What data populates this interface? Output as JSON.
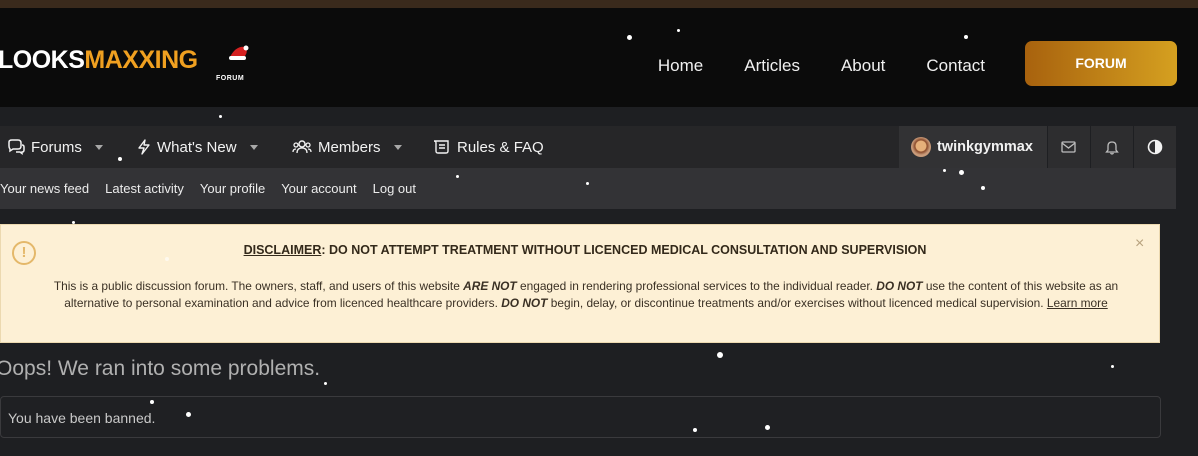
{
  "header": {
    "logo_left": "LOOKS",
    "logo_right": "MAXXING",
    "logo_sub": "FORUM",
    "nav": [
      "Home",
      "Articles",
      "About",
      "Contact"
    ],
    "forum_button": "FORUM"
  },
  "forum_nav": {
    "items": [
      {
        "label": "Forums",
        "icon": "forums-icon"
      },
      {
        "label": "What's New",
        "icon": "bolt-icon"
      },
      {
        "label": "Members",
        "icon": "members-icon"
      },
      {
        "label": "Rules & FAQ",
        "icon": "rules-icon"
      }
    ],
    "username": "twinkgymmax"
  },
  "sub_nav": [
    "Your news feed",
    "Latest activity",
    "Your profile",
    "Your account",
    "Log out"
  ],
  "notice": {
    "title_underlined": "DISCLAIMER",
    "title_rest": ": DO NOT ATTEMPT TREATMENT WITHOUT LICENCED MEDICAL CONSULTATION AND SUPERVISION",
    "body_1": "This is a public discussion forum. The owners, staff, and users of this website ",
    "em_1": "ARE NOT",
    "body_2": " engaged in rendering professional services to the individual reader. ",
    "em_2": "DO NOT",
    "body_3": " use the content of this website as an alternative to personal examination and advice from licenced healthcare providers. ",
    "em_3": "DO NOT",
    "body_4": " begin, delay, or discontinue treatments and/or exercises without licenced medical supervision. ",
    "learn_more": "Learn more",
    "close": "×"
  },
  "error": {
    "title": "Oops! We ran into some problems.",
    "message": "You have been banned."
  },
  "colors": {
    "accent": "#f0a020",
    "notice_bg": "#fdf0d5"
  }
}
